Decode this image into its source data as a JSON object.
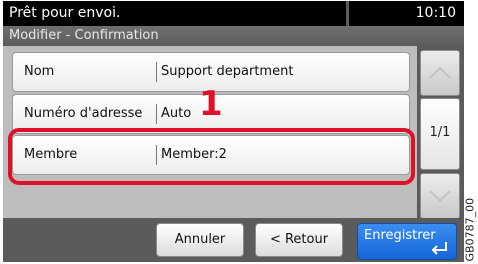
{
  "status": {
    "message": "Prêt pour envoi.",
    "time": "10:10"
  },
  "screen_title": "Modifier - Confirmation",
  "rows": [
    {
      "label": "Nom",
      "value": "Support department"
    },
    {
      "label": "Numéro d'adresse",
      "value": "Auto"
    },
    {
      "label": "Membre",
      "value": "Member:2"
    }
  ],
  "callout_number": "1",
  "pagination": {
    "indicator": "1/1"
  },
  "buttons": {
    "cancel": "Annuler",
    "back": "< Retour",
    "save": "Enregistrer"
  },
  "reference_code": "GB0787_00",
  "colors": {
    "highlight": "#e0102a",
    "primary": "#1a72e0"
  },
  "icons": {
    "up": "chevron-up-icon",
    "down": "chevron-down-icon",
    "enter": "enter-return-icon"
  }
}
